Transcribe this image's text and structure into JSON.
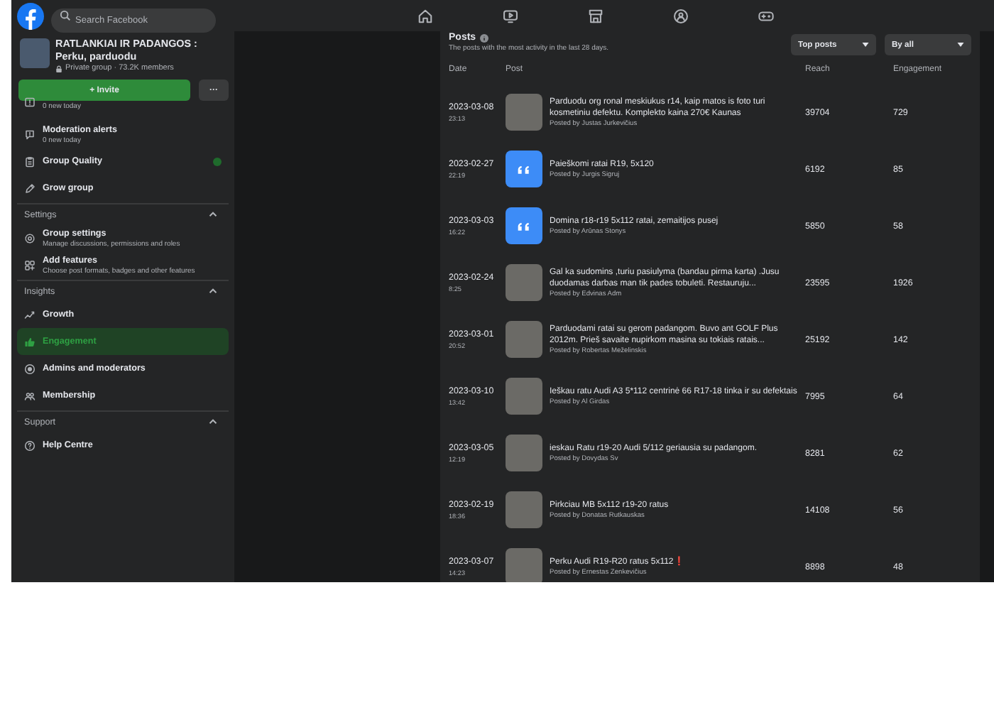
{
  "topbar": {
    "search": {
      "placeholder": "Search Facebook"
    },
    "nav": [
      {
        "selected": false
      },
      {
        "selected": false
      },
      {
        "selected": false
      },
      {
        "selected": false
      },
      {
        "selected": false
      }
    ]
  },
  "group": {
    "name": "RATLANKIAI IR PADANGOS : Perku, parduodu",
    "meta": "Private group · 73.2K members",
    "invite": "+ Invite",
    "more": "···"
  },
  "sidebar": [
    {
      "kind": "item",
      "subtitle": "0 new today",
      "selected": false
    },
    {
      "kind": "item",
      "label": "Moderation alerts",
      "subtitle": "0 new today",
      "selected": false
    },
    {
      "kind": "item",
      "label": "Group Quality",
      "badge": true,
      "selected": false
    },
    {
      "kind": "item",
      "label": "Grow group",
      "selected": false
    },
    {
      "kind": "section",
      "label": "Settings",
      "expanded": true
    },
    {
      "kind": "item",
      "label": "Group settings",
      "subtitle": "Manage discussions, permissions and roles",
      "selected": false
    },
    {
      "kind": "item",
      "label": "Add features",
      "subtitle": "Choose post formats, badges and other features",
      "selected": false
    },
    {
      "kind": "section",
      "label": "Insights",
      "expanded": true
    },
    {
      "kind": "item",
      "label": "Growth",
      "selected": false
    },
    {
      "kind": "item",
      "label": "Engagement",
      "selected": true
    },
    {
      "kind": "item",
      "label": "Admins and moderators",
      "selected": false
    },
    {
      "kind": "item",
      "label": "Membership",
      "selected": false
    },
    {
      "kind": "section",
      "label": "Support",
      "expanded": true
    },
    {
      "kind": "item",
      "label": "Help Centre",
      "selected": false
    }
  ],
  "posts": {
    "title": "Posts",
    "subtitle": "The posts with the most activity in the last 28 days.",
    "filters": [
      "Top posts",
      "By all"
    ],
    "columns": [
      "Date",
      "Post",
      "Reach",
      "Engagement"
    ],
    "rows": [
      {
        "date": "2023-03-08",
        "time": "23:13",
        "kind": "photo",
        "text": "Parduodu org ronal meskiukus r14, kaip matos is foto turi kosmetiniu defektu. Komplekto kaina 270€ Kaunas",
        "author": "Posted by Justas Jurkevičius",
        "reach": "39704",
        "engagement": "729"
      },
      {
        "date": "2023-02-27",
        "time": "22:19",
        "kind": "quote",
        "text": "Paieškomi ratai R19, 5x120",
        "author": "Posted by Jurgis Sigruj",
        "reach": "6192",
        "engagement": "85"
      },
      {
        "date": "2023-03-03",
        "time": "16:22",
        "kind": "quote",
        "text": "Domina r18-r19 5x112 ratai, zemaitijos pusej",
        "author": "Posted by Arūnas Stonys",
        "reach": "5850",
        "engagement": "58"
      },
      {
        "date": "2023-02-24",
        "time": "8:25",
        "kind": "photo",
        "text": "Gal ka sudomins ,turiu pasiulyma (bandau pirma karta) .Jusu duodamas darbas man tik pades tobuleti. Restauruju...",
        "author": "Posted by Edvinas Adm",
        "reach": "23595",
        "engagement": "1926"
      },
      {
        "date": "2023-03-01",
        "time": "20:52",
        "kind": "photo",
        "text": "Parduodami ratai su gerom padangom. Buvo ant GOLF Plus 2012m. Prieš savaite nupirkom masina su tokiais ratais...",
        "author": "Posted by Robertas Meželinskis",
        "reach": "25192",
        "engagement": "142"
      },
      {
        "date": "2023-03-10",
        "time": "13:42",
        "kind": "photo",
        "text": "Ieškau ratu Audi A3 5*112 centrinė 66 R17-18 tinka ir su defektais",
        "author": "Posted by Al Girdas",
        "reach": "7995",
        "engagement": "64"
      },
      {
        "date": "2023-03-05",
        "time": "12:19",
        "kind": "photo",
        "text": "ieskau Ratu r19-20 Audi 5/112 geriausia su padangom.",
        "author": "Posted by Dovydas Sv",
        "reach": "8281",
        "engagement": "62"
      },
      {
        "date": "2023-02-19",
        "time": "18:36",
        "kind": "photo",
        "text": "Pirkciau MB 5x112 r19-20 ratus",
        "author": "Posted by Donatas Rutkauskas",
        "reach": "14108",
        "engagement": "56"
      },
      {
        "date": "2023-03-07",
        "time": "14:23",
        "kind": "photo",
        "text": "Perku Audi R19-R20 ratus 5x112❗",
        "author": "Posted by Ernestas Zenkevičius",
        "reach": "8898",
        "engagement": "48"
      }
    ]
  }
}
